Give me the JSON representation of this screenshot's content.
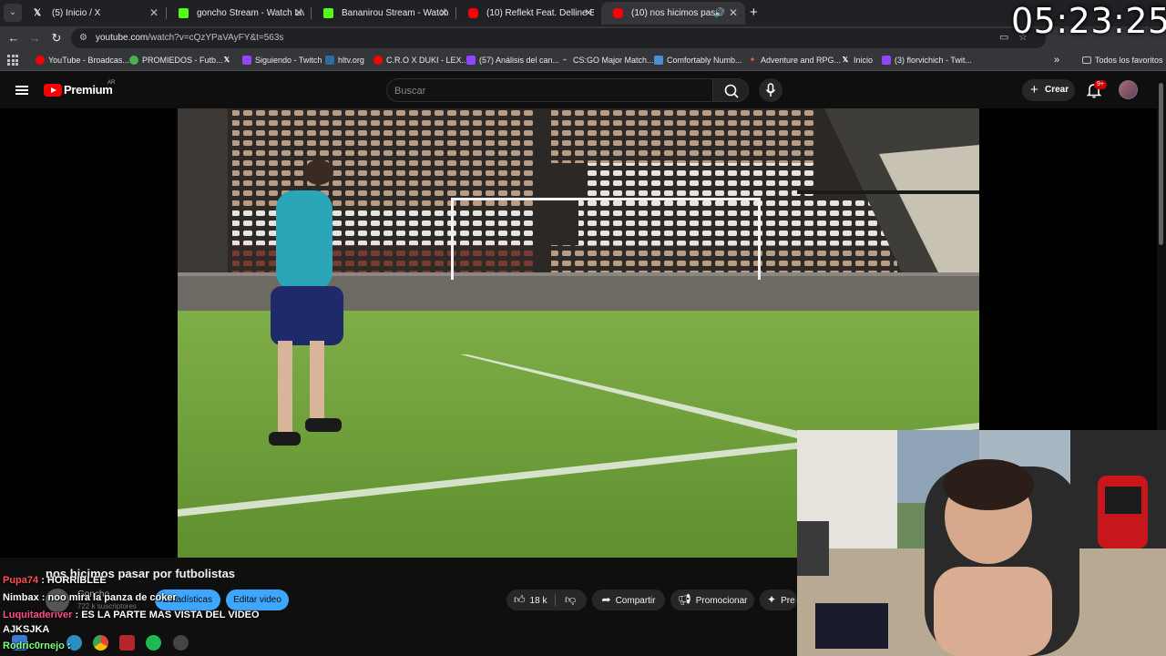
{
  "browser": {
    "tabs": [
      {
        "label": "(5) Inicio / X",
        "favicon": "x-icon",
        "active": false
      },
      {
        "label": "goncho Stream - Watch Live on",
        "favicon": "kick-icon",
        "active": false
      },
      {
        "label": "Bananirou Stream - Watch Live",
        "favicon": "kick-icon",
        "active": false
      },
      {
        "label": "(10) Reflekt Feat. Delline Bass -",
        "favicon": "youtube-icon",
        "active": false
      },
      {
        "label": "(10) nos hicimos pasar por",
        "favicon": "youtube-icon",
        "active": true
      }
    ],
    "url_host": "youtube.com",
    "url_rest": "/watch?v=cQzYPaVAyFY&t=563s",
    "bookmarks": [
      "YouTube - Broadcas...",
      "PROMIEDOS - Futb...",
      "",
      "Siguiendo - Twitch",
      "hltv.org",
      "C.R.O X DUKI - LEX...",
      "(57) Análisis del can...",
      "CS:GO Major Match...",
      "Comfortably Numb...",
      "Adventure and RPG...",
      "Inicio",
      "(3) florvichich - Twit..."
    ],
    "bookmarks_folder": "Todos los favoritos"
  },
  "overlay": {
    "clock": "05:23:25"
  },
  "youtube": {
    "brand": "Premium",
    "region": "AR",
    "search_placeholder": "Buscar",
    "create_label": "Crear",
    "notif_count": "9+"
  },
  "video": {
    "title": "nos hicimos pasar por futbolistas",
    "channel": "Goncho",
    "subscribers": "722 k suscriptores",
    "stats_label": "Estadísticas",
    "edit_label": "Editar video",
    "likes": "18 k",
    "share_label": "Compartir",
    "promote_label": "Promocionar",
    "more_label": "Pre"
  },
  "chat": [
    {
      "user": "Pupa74",
      "message": "HORRIBLEE",
      "color": "#ff4f4f"
    },
    {
      "user": "Nimbax",
      "message": "noo mira la panza de coker",
      "color": "#ffffff"
    },
    {
      "user": "Luquitaderiver",
      "message": "ES LA PARTE MAS VISTA DEL VIDEO",
      "color": "#ff4f8a"
    },
    {
      "user": "",
      "message": "AJKSJKA",
      "color": "#ffffff"
    },
    {
      "user": "Rodric0rnejo",
      "message": "",
      "color": "#7fff7f"
    }
  ],
  "colors": {
    "yt_red": "#ff0000",
    "accent_blue": "#3ea6ff",
    "chrome_dark": "#202124"
  }
}
